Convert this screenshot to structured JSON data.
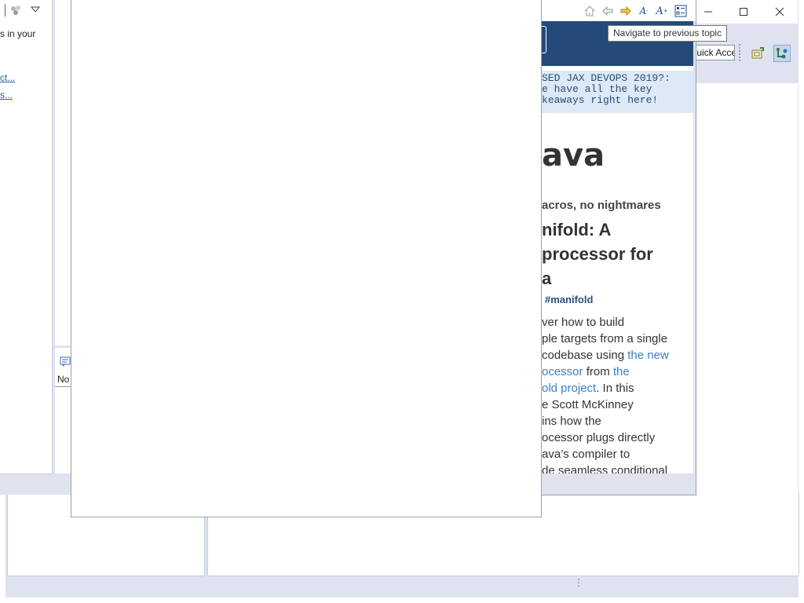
{
  "left_window": {
    "text_fragment": "s in your",
    "link_1": "ct...",
    "link_2": "s...",
    "bottom_text": "No"
  },
  "help_browser": {
    "toolbar": {
      "home": "home-icon",
      "back": "back-arrow-icon",
      "forward": "forward-arrow-icon",
      "decrease_font": "font-decrease-icon",
      "increase_font": "font-increase-icon",
      "toc_sync": "show-in-toc-icon"
    },
    "tooltip": "Navigate to previous topic",
    "page": {
      "banner_lines": [
        "SED JAX DEVOPS 2019?:",
        "e have all the key",
        "keaways right here!"
      ],
      "big_title": "ava",
      "subtitle": "acros, no nightmares",
      "article_title_lines": [
        "nifold: A",
        "processor for",
        "a"
      ],
      "tag": "#manifold",
      "body": {
        "line1": "ver how to build",
        "line2": "ple targets from a single",
        "line3_pre": "codebase using ",
        "line3_link": "the new",
        "line4_link": "ocessor",
        "line4_mid": " from ",
        "line4_link2": "the",
        "line5_link": "old project",
        "line5_post": ". In this",
        "line6": "e Scott McKinney",
        "line7": "ins how the",
        "line8": "ocessor plugs directly",
        "line9": "ava’s compiler to",
        "line10": "de seamless conditional"
      }
    }
  },
  "workbench": {
    "quick_access": "Quick Access",
    "window_controls": {
      "minimize": "minimize-icon",
      "maximize": "maximize-icon",
      "close": "close-icon"
    }
  },
  "colors": {
    "header_blue": "#244a7a",
    "banner_bg": "#dde9f6",
    "link": "#3a80c8",
    "workbench_bg": "#dfe3f0"
  }
}
